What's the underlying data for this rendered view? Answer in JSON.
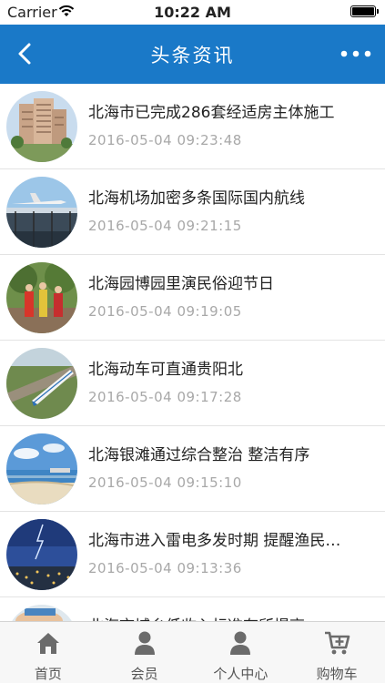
{
  "status_bar": {
    "carrier": "Carrier",
    "time": "10:22 AM"
  },
  "header": {
    "title": "头条资讯",
    "back_icon": "chevron-left-icon",
    "more_icon": "more-dots-icon"
  },
  "news": [
    {
      "title": "北海市已完成286套经适房主体施工",
      "date": "2016-05-04 09:23:48"
    },
    {
      "title": "北海机场加密多条国际国内航线",
      "date": "2016-05-04 09:21:15"
    },
    {
      "title": "北海园博园里演民俗迎节日",
      "date": "2016-05-04 09:19:05"
    },
    {
      "title": "北海动车可直通贵阳北",
      "date": "2016-05-04 09:17:28"
    },
    {
      "title": "北海银滩通过综合整治 整洁有序",
      "date": "2016-05-04 09:15:10"
    },
    {
      "title": "北海市进入雷电多发时期 提醒渔民…",
      "date": "2016-05-04 09:13:36"
    },
    {
      "title": "北海市城乡低收入标准有所提高",
      "date": ""
    }
  ],
  "tabbar": {
    "items": [
      {
        "label": "首页",
        "icon": "home-icon"
      },
      {
        "label": "会员",
        "icon": "member-icon"
      },
      {
        "label": "个人中心",
        "icon": "user-icon"
      },
      {
        "label": "购物车",
        "icon": "cart-icon"
      }
    ]
  },
  "colors": {
    "navbar": "#1a79c8",
    "tab_icon": "#6b6b6b",
    "date_text": "#a8a8a8"
  }
}
